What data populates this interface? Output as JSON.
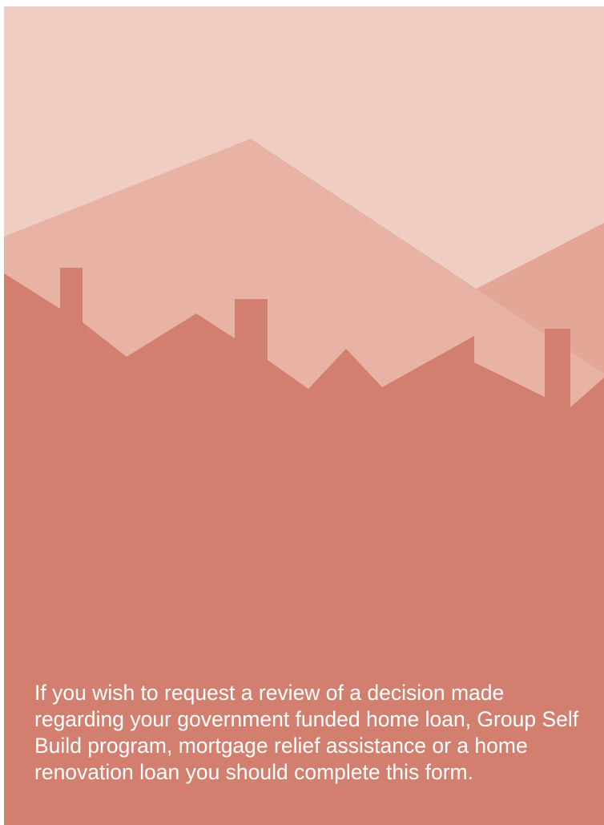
{
  "colors": {
    "sky": "#f0cdc2",
    "mountain_back": "#e4a697",
    "mountain_front": "#e8b3a4",
    "houses": "#d27f70",
    "text": "#ffffff"
  },
  "intro": {
    "text": "If you wish to request a review of a decision made regarding your government funded home loan, Group Self Build program, mortgage relief assistance or a home renovation loan you should complete this form."
  }
}
